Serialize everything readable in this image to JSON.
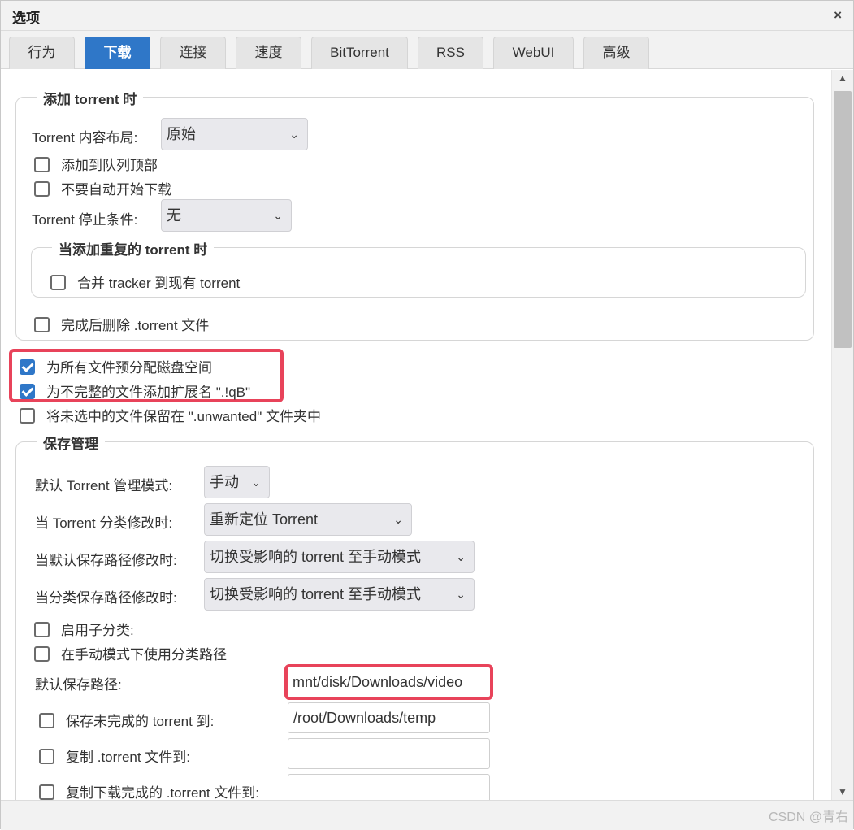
{
  "window": {
    "title": "选项",
    "close_glyph": "×"
  },
  "tabs": [
    {
      "label": "行为",
      "active": false
    },
    {
      "label": "下载",
      "active": true
    },
    {
      "label": "连接",
      "active": false
    },
    {
      "label": "速度",
      "active": false
    },
    {
      "label": "BitTorrent",
      "active": false
    },
    {
      "label": "RSS",
      "active": false
    },
    {
      "label": "WebUI",
      "active": false
    },
    {
      "label": "高级",
      "active": false
    }
  ],
  "add_torrent": {
    "legend": "添加 torrent 时",
    "layout_label": "Torrent 内容布局:",
    "layout_value": "原始",
    "add_to_top_label": "添加到队列顶部",
    "add_to_top_checked": false,
    "no_autostart_label": "不要自动开始下载",
    "no_autostart_checked": false,
    "stop_condition_label": "Torrent 停止条件:",
    "stop_condition_value": "无",
    "duplicate": {
      "legend": "当添加重复的 torrent 时",
      "merge_trackers_label": "合并 tracker 到现有 torrent",
      "merge_trackers_checked": false
    },
    "delete_after_label": "完成后删除 .torrent 文件",
    "delete_after_checked": false
  },
  "options": {
    "preallocate_label": "为所有文件预分配磁盘空间",
    "preallocate_checked": true,
    "append_ext_label": "为不完整的文件添加扩展名 \".!qB\"",
    "append_ext_checked": true,
    "keep_unwanted_label": "将未选中的文件保留在 \".unwanted\" 文件夹中",
    "keep_unwanted_checked": false
  },
  "save_management": {
    "legend": "保存管理",
    "mode_label": "默认 Torrent 管理模式:",
    "mode_value": "手动",
    "category_changed_label": "当 Torrent 分类修改时:",
    "category_changed_value": "重新定位 Torrent",
    "default_path_changed_label": "当默认保存路径修改时:",
    "default_path_changed_value": "切换受影响的 torrent 至手动模式",
    "category_path_changed_label": "当分类保存路径修改时:",
    "category_path_changed_value": "切换受影响的 torrent 至手动模式",
    "subcategories_label": "启用子分类:",
    "subcategories_checked": false,
    "use_category_paths_label": "在手动模式下使用分类路径",
    "use_category_paths_checked": false,
    "default_save_path_label": "默认保存路径:",
    "default_save_path_value": "mnt/disk/Downloads/video",
    "incomplete_label": "保存未完成的 torrent 到:",
    "incomplete_checked": false,
    "incomplete_value": "/root/Downloads/temp",
    "copy_torrent_label": "复制 .torrent 文件到:",
    "copy_torrent_checked": false,
    "copy_torrent_value": "",
    "copy_finished_label": "复制下载完成的 .torrent 文件到:",
    "copy_finished_checked": false,
    "copy_finished_value": ""
  },
  "scrollbar": {
    "up_glyph": "▲",
    "down_glyph": "▼"
  },
  "watermark": "CSDN @青右",
  "colors": {
    "accent": "#2f77c8",
    "highlight": "#e8435a"
  }
}
